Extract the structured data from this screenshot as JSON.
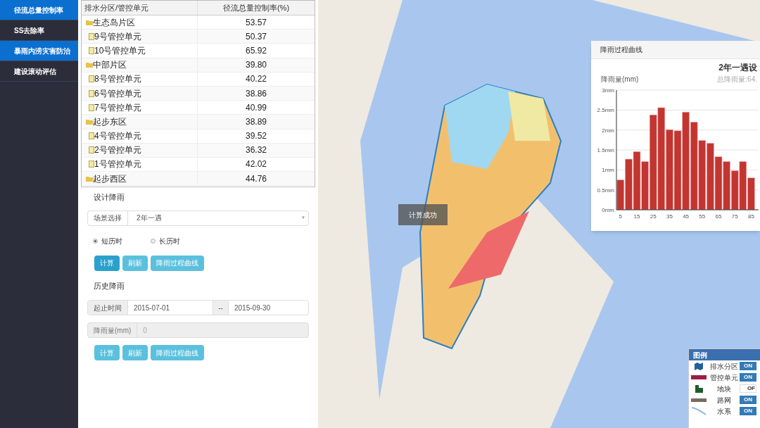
{
  "sidebar": {
    "items": [
      {
        "label": "径流总量控制率",
        "selected": true
      },
      {
        "label": "SS去除率",
        "selected": false
      },
      {
        "label": "暴雨内涝灾害防治",
        "selected": true
      },
      {
        "label": "建设滚动评估",
        "selected": false
      }
    ]
  },
  "table": {
    "columns": [
      "排水分区/管控单元",
      "径流总量控制率(%)"
    ],
    "rows": [
      {
        "kind": "folder",
        "name": "生态岛片区",
        "value": "53.57"
      },
      {
        "kind": "file",
        "name": "9号管控单元",
        "value": "50.37"
      },
      {
        "kind": "file",
        "name": "10号管控单元",
        "value": "65.92"
      },
      {
        "kind": "folder",
        "name": "中部片区",
        "value": "39.80"
      },
      {
        "kind": "file",
        "name": "8号管控单元",
        "value": "40.22"
      },
      {
        "kind": "file",
        "name": "6号管控单元",
        "value": "38.86"
      },
      {
        "kind": "file",
        "name": "7号管控单元",
        "value": "40.99"
      },
      {
        "kind": "folder",
        "name": "起步东区",
        "value": "38.89"
      },
      {
        "kind": "file",
        "name": "4号管控单元",
        "value": "39.52"
      },
      {
        "kind": "file",
        "name": "2号管控单元",
        "value": "36.32"
      },
      {
        "kind": "file",
        "name": "1号管控单元",
        "value": "42.02"
      },
      {
        "kind": "folder",
        "name": "起步西区",
        "value": "44.76"
      }
    ]
  },
  "design_rain": {
    "title": "设计降雨",
    "scene_label": "场景选择",
    "scene_value": "2年一遇",
    "scene_caret": "▼",
    "radios": [
      {
        "label": "短历时",
        "selected": true
      },
      {
        "label": "长历时",
        "selected": false
      }
    ],
    "buttons": [
      {
        "label": "计算",
        "selected": true
      },
      {
        "label": "刷新",
        "selected": false
      },
      {
        "label": "降雨过程曲线",
        "selected": false
      }
    ]
  },
  "history_rain": {
    "title": "历史降雨",
    "period_label": "起止时间",
    "start": "2015-07-01",
    "separator": "--",
    "end": "2015-09-30",
    "amount_label": "降雨量(mm)",
    "amount_value": "0",
    "buttons": [
      {
        "label": "计算",
        "selected": false
      },
      {
        "label": "刷新",
        "selected": false
      },
      {
        "label": "降雨过程曲线",
        "selected": false
      }
    ]
  },
  "toast": "计算成功",
  "chart_panel": {
    "title": "降雨过程曲线",
    "chart_title": "2年一遇设",
    "subtitle": "总降雨量:64.",
    "chart_data": {
      "type": "bar",
      "ylabel": "降雨量(mm)",
      "x": [
        5,
        10,
        15,
        20,
        25,
        30,
        35,
        40,
        45,
        50,
        55,
        60,
        65,
        70,
        75,
        80,
        85
      ],
      "series": [
        {
          "color": "#c23531",
          "values": [
            0.75,
            1.27,
            1.46,
            1.21,
            2.38,
            2.56,
            2.01,
            1.98,
            2.45,
            2.2,
            1.74,
            1.67,
            1.33,
            1.21,
            0.98,
            1.21,
            0.8
          ]
        }
      ],
      "xlim": [
        2.5,
        87.5
      ],
      "ylim": [
        0,
        3
      ],
      "grid": true,
      "yticks": [
        {
          "value": 0,
          "label": "0mm"
        },
        {
          "value": 0.5,
          "label": "0.5mm"
        },
        {
          "value": 1,
          "label": "1mm"
        },
        {
          "value": 1.5,
          "label": "1.5mm"
        },
        {
          "value": 2,
          "label": "2mm"
        },
        {
          "value": 2.5,
          "label": "2.5mm"
        },
        {
          "value": 3,
          "label": "3mm"
        }
      ],
      "xticks": [
        5,
        15,
        25,
        35,
        45,
        55,
        65,
        75,
        85
      ]
    }
  },
  "legend": {
    "title": "图例",
    "items": [
      {
        "kind": "district",
        "label": "排水分区",
        "on": true,
        "toggle": "ON"
      },
      {
        "kind": "unit",
        "label": "管控单元",
        "on": true,
        "toggle": "ON"
      },
      {
        "kind": "parcel",
        "label": "地块",
        "on": false,
        "toggle": "OF"
      },
      {
        "kind": "road",
        "label": "路网",
        "on": true,
        "toggle": "ON"
      },
      {
        "kind": "water",
        "label": "水系",
        "on": true,
        "toggle": "ON"
      }
    ]
  }
}
